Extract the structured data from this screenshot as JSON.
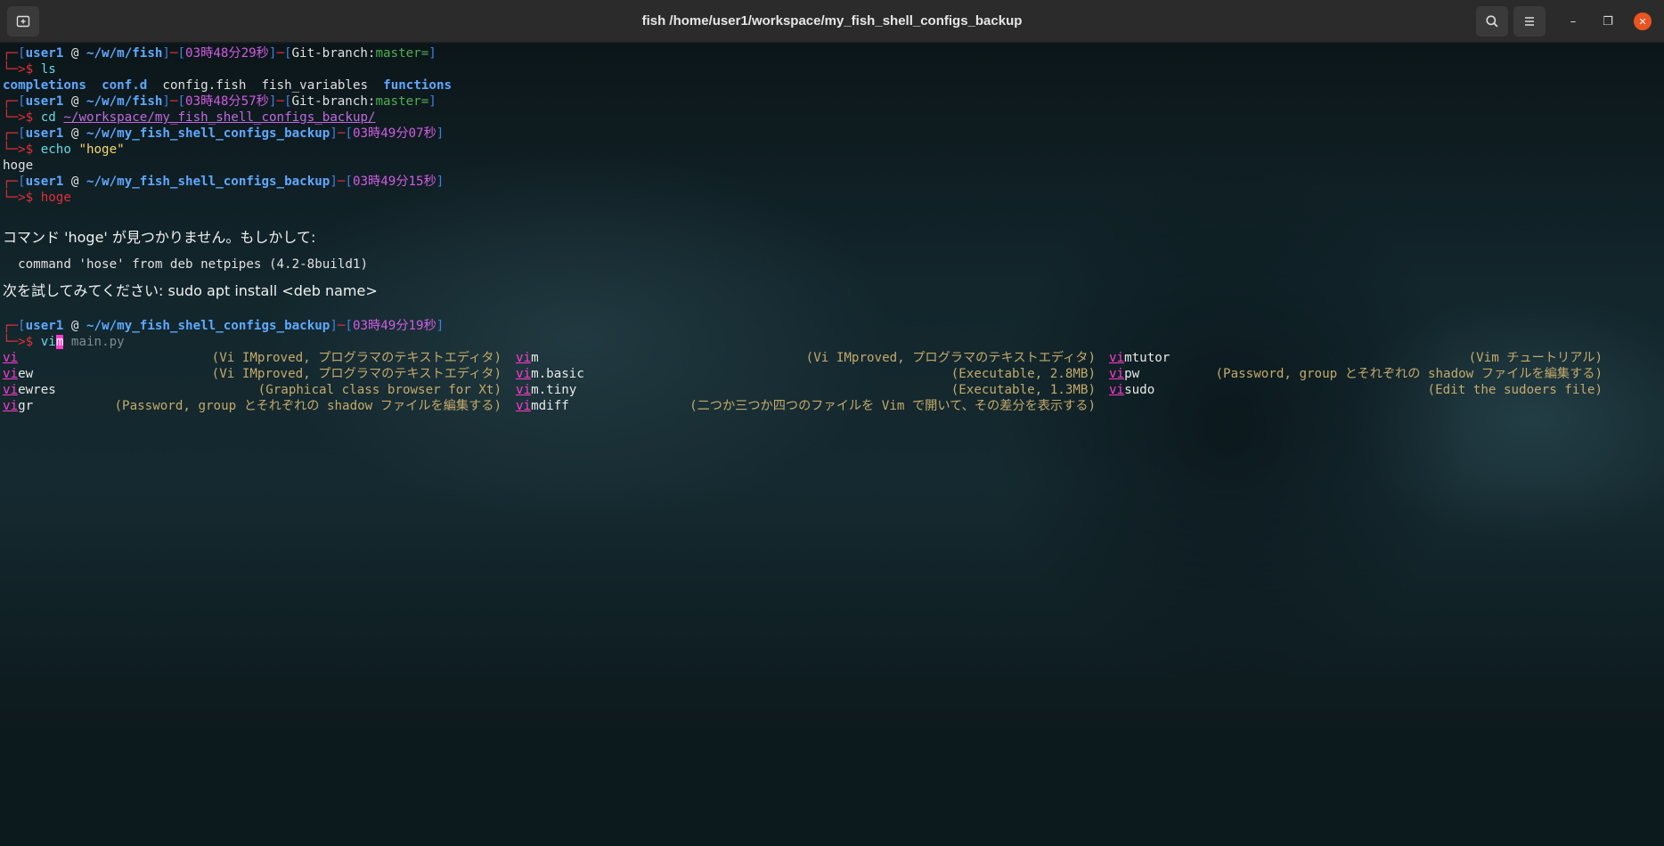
{
  "window": {
    "title": "fish /home/user1/workspace/my_fish_shell_configs_backup",
    "new_tab_icon": "terminal-plus-icon",
    "search_icon": "search-icon",
    "menu_icon": "hamburger-menu-icon",
    "minimize_glyph": "–",
    "maximize_glyph": "❐",
    "close_glyph": "✕"
  },
  "colors": {
    "prompt_frame": "#e0303a",
    "user": "#5fa8ff",
    "time": "#d05ce3",
    "branch": "#4caf50",
    "command": "#67d8e3",
    "string": "#f5d76e",
    "completion_prefix": "#ff3ad0",
    "completion_desc": "#c4a96a"
  },
  "terminal": {
    "frame_top": "┌─",
    "frame_bottom": "└─",
    "prompt_arrow": ">$ ",
    "at": " @ ",
    "lb": "[",
    "rb": "]",
    "dash": "─",
    "git_prefix": "Git-branch:",
    "p1_user": "user1",
    "p1_dir": "~/w/m/fish",
    "p1_time": "03時48分29秒",
    "p1_branch": "master=",
    "p1_cmd": "ls",
    "ls_out": [
      "completions",
      "conf.d",
      "config.fish",
      "fish_variables",
      "functions"
    ],
    "p2_user": "user1",
    "p2_dir": "~/w/m/fish",
    "p2_time": "03時48分57秒",
    "p2_branch": "master=",
    "p2_cmd": "cd",
    "p2_arg": "~/workspace/my_fish_shell_configs_backup/",
    "p3_user": "user1",
    "p3_dir": "~/w/my_fish_shell_configs_backup",
    "p3_time": "03時49分07秒",
    "p3_cmd": "echo",
    "p3_arg": "\"hoge\"",
    "p3_out": "hoge",
    "p4_user": "user1",
    "p4_dir": "~/w/my_fish_shell_configs_backup",
    "p4_time": "03時49分15秒",
    "p4_cmd": "hoge",
    "err1": "コマンド 'hoge' が見つかりません。もしかして:",
    "err2": "  command 'hose' from deb netpipes (4.2-8build1)",
    "err3": "次を試してみてください: sudo apt install <deb name>",
    "p5_user": "user1",
    "p5_dir": "~/w/my_fish_shell_configs_backup",
    "p5_time": "03時49分19秒",
    "p5_typed_a": "vi",
    "p5_cursor": "m",
    "p5_suggest": " main.py"
  },
  "completions": [
    {
      "prefix": "vi",
      "rest": "",
      "desc": "(Vi IMproved, プログラマのテキストエディタ)"
    },
    {
      "prefix": "vi",
      "rest": "m",
      "desc": "(Vi IMproved, プログラマのテキストエディタ)"
    },
    {
      "prefix": "vi",
      "rest": "mtutor",
      "desc": "(Vim チュートリアル)"
    },
    {
      "prefix": "vi",
      "rest": "ew",
      "desc": "(Vi IMproved, プログラマのテキストエディタ)"
    },
    {
      "prefix": "vi",
      "rest": "m.basic",
      "desc": "(Executable, 2.8MB)"
    },
    {
      "prefix": "vi",
      "rest": "pw",
      "desc": "(Password, group とそれぞれの shadow ファイルを編集する)"
    },
    {
      "prefix": "vi",
      "rest": "ewres",
      "desc": "(Graphical class browser for Xt)"
    },
    {
      "prefix": "vi",
      "rest": "m.tiny",
      "desc": "(Executable, 1.3MB)"
    },
    {
      "prefix": "vi",
      "rest": "sudo",
      "desc": "(Edit the sudoers file)"
    },
    {
      "prefix": "vi",
      "rest": "gr",
      "desc": "(Password, group とそれぞれの shadow ファイルを編集する)"
    },
    {
      "prefix": "vi",
      "rest": "mdiff",
      "desc": "(二つか三つか四つのファイルを Vim で開いて、その差分を表示する)"
    }
  ]
}
